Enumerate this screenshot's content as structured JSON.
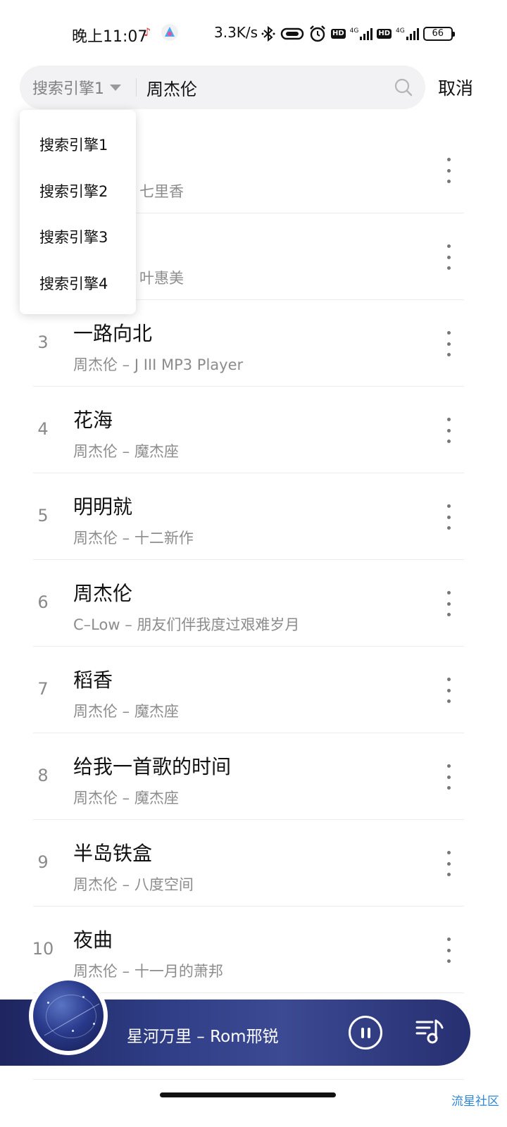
{
  "status_bar": {
    "time": "晚上11:07",
    "speed": "3.3K/s",
    "network_1": "4G",
    "network_2": "4G",
    "hd_label": "HD",
    "battery": "66"
  },
  "search": {
    "engine_selected": "搜索引擎1",
    "query": "周杰伦",
    "cancel_label": "取消"
  },
  "dropdown": {
    "options": [
      "搜索引擎1",
      "搜索引擎2",
      "搜索引擎3",
      "搜索引擎4"
    ]
  },
  "songs": [
    {
      "index": "",
      "title": "",
      "subtitle": "七里香"
    },
    {
      "index": "",
      "title": "",
      "subtitle": "叶惠美"
    },
    {
      "index": "3",
      "title": "一路向北",
      "subtitle": "周杰伦 – J III MP3 Player"
    },
    {
      "index": "4",
      "title": "花海",
      "subtitle": "周杰伦 – 魔杰座"
    },
    {
      "index": "5",
      "title": "明明就",
      "subtitle": "周杰伦 – 十二新作"
    },
    {
      "index": "6",
      "title": "周杰伦",
      "subtitle": "C–Low – 朋友们伴我度过艰难岁月"
    },
    {
      "index": "7",
      "title": "稻香",
      "subtitle": "周杰伦 – 魔杰座"
    },
    {
      "index": "8",
      "title": "给我一首歌的时间",
      "subtitle": "周杰伦 – 魔杰座"
    },
    {
      "index": "9",
      "title": "半岛铁盒",
      "subtitle": "周杰伦 – 八度空间"
    },
    {
      "index": "10",
      "title": "夜曲",
      "subtitle": "周杰伦 – 十一月的萧邦"
    }
  ],
  "player": {
    "track": "星河万里 – Rom邢锐",
    "playing": true
  },
  "watermark": "流星社区",
  "colors": {
    "player_gradient_start": "#1e2560",
    "player_gradient_end": "#262f70",
    "text_secondary": "#8c8c8c",
    "watermark": "#2f86d6"
  }
}
